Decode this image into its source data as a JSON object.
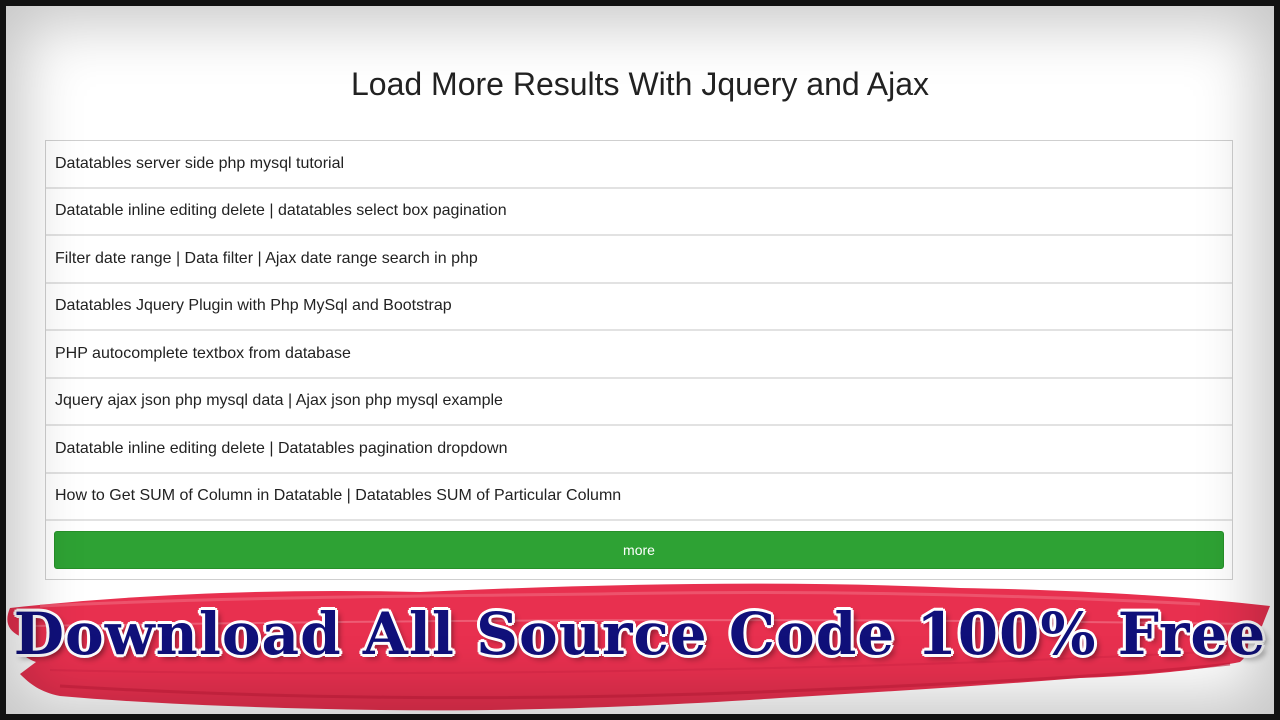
{
  "page": {
    "title": "Load More Results With Jquery and Ajax"
  },
  "list": {
    "items": [
      {
        "label": "Datatables server side php mysql tutorial"
      },
      {
        "label": "Datatable inline editing delete | datatables select box pagination"
      },
      {
        "label": "Filter date range | Data filter | Ajax date range search in php"
      },
      {
        "label": "Datatables Jquery Plugin with Php MySql and Bootstrap"
      },
      {
        "label": "PHP autocomplete textbox from database"
      },
      {
        "label": "Jquery ajax json php mysql data | Ajax json php mysql example"
      },
      {
        "label": "Datatable inline editing delete | Datatables pagination dropdown"
      },
      {
        "label": "How to Get SUM of Column in Datatable | Datatables SUM of Particular Column"
      }
    ],
    "more_button_label": "more"
  },
  "banner": {
    "text": "Download All Source Code 100% Free"
  },
  "colors": {
    "button_green": "#2ea234",
    "banner_red": "#e8304f",
    "banner_text": "#10107a"
  }
}
